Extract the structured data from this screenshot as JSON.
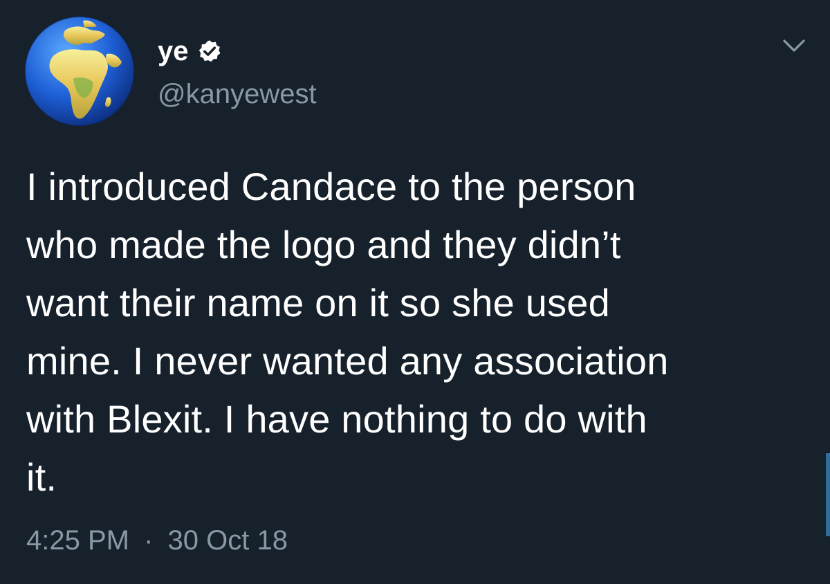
{
  "user": {
    "display_name": "ye",
    "handle": "@kanyewest",
    "verified": true,
    "avatar_icon": "globe-africa-europe-icon"
  },
  "tweet": {
    "text_lines": [
      "I introduced Candace to the person",
      "who made the logo and they didn’t",
      "want their name on it so she used",
      "mine. I never wanted any association",
      "with Blexit. I have nothing to do with",
      "it."
    ],
    "time": "4:25 PM",
    "separator": "·",
    "date": "30 Oct 18"
  },
  "colors": {
    "background": "#17212c",
    "text": "#ffffff",
    "secondary_text": "#8899a6",
    "verified_badge": "#ffffff"
  },
  "icons": {
    "verified": "verified-badge-icon",
    "more": "chevron-down-icon"
  }
}
